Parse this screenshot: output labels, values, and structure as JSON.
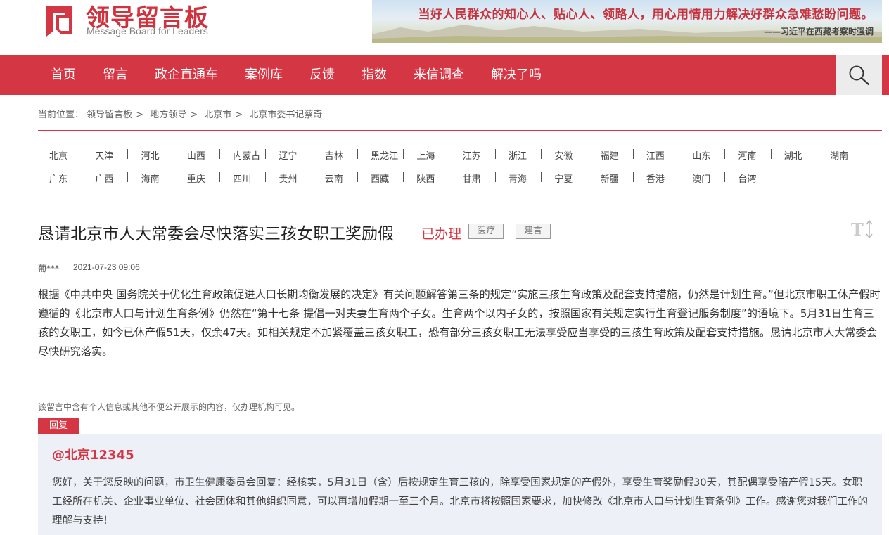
{
  "site": {
    "logo_cn": "领导留言板",
    "logo_en": "Message Board for Leaders",
    "banner_quote": "当好人民群众的知心人、贴心人、领路人，用心用情用力解决好群众急难愁盼问题。",
    "banner_source": "——习近平在西藏考察时强调"
  },
  "nav": {
    "items": [
      "首页",
      "留言",
      "政企直通车",
      "案例库",
      "反馈",
      "指数",
      "来信调查",
      "解决了吗"
    ]
  },
  "breadcrumb": {
    "prefix": "当前位置：",
    "items": [
      "领导留言板",
      "地方领导",
      "北京市",
      "北京市委书记蔡奇"
    ],
    "separator": ">"
  },
  "regions": {
    "row1": [
      "北京",
      "天津",
      "河北",
      "山西",
      "内蒙古",
      "辽宁",
      "吉林",
      "黑龙江",
      "上海",
      "江苏",
      "浙江",
      "安徽",
      "福建",
      "江西",
      "山东",
      "河南",
      "湖北",
      "湖南"
    ],
    "row2": [
      "广东",
      "广西",
      "海南",
      "重庆",
      "四川",
      "贵州",
      "云南",
      "西藏",
      "陕西",
      "甘肃",
      "青海",
      "宁夏",
      "新疆",
      "香港",
      "澳门",
      "台湾"
    ]
  },
  "message": {
    "title": "恳请北京市人大常委会尽快落实三孩女职工奖励假",
    "status": "已办理",
    "tags": [
      "医疗",
      "建言"
    ],
    "author": "葡***",
    "time": "2021-07-23 09:06",
    "body": "根据《中共中央 国务院关于优化生育政策促进人口长期均衡发展的决定》有关问题解答第三条的规定“实施三孩生育政策及配套支持措施，仍然是计划生育。”但北京市职工休产假时遵循的《北京市人口与计划生育条例》仍然在“第十七条 提倡一对夫妻生育两个子女。生育两个以内子女的，按照国家有关规定实行生育登记服务制度”的语境下。5月31日生育三孩的女职工，如今已休产假51天，仅余47天。如相关规定不加紧覆盖三孩女职工，恐有部分三孩女职工无法享受应当享受的三孩生育政策及配套支持措施。恳请北京市人大常委会尽快研究落实。",
    "privacy_note": "该留言中含有个人信息或其他不便公开展示的内容，仅办理机构可见。"
  },
  "reply": {
    "tab_label": "回复",
    "author": "@北京12345",
    "text": "您好，关于您反映的问题，市卫生健康委员会回复：经核实，5月31日（含）后按规定生育三孩的，除享受国家规定的产假外，享受生育奖励假30天，其配偶享受陪产假15天。女职工经所在机关、企业事业单位、社会团体和其他组织同意，可以再增加假期一至三个月。北京市将按照国家要求，加快修改《北京市人口与计划生育条例》工作。感谢您对我们工作的理解与支持！"
  },
  "icons": {
    "search": "search-icon",
    "font_size": "font-size-icon",
    "logo": "logo-icon"
  },
  "colors": {
    "brand_red": "#d53644",
    "nav_bg": "#d53644",
    "reply_bg": "#eef0f7"
  }
}
